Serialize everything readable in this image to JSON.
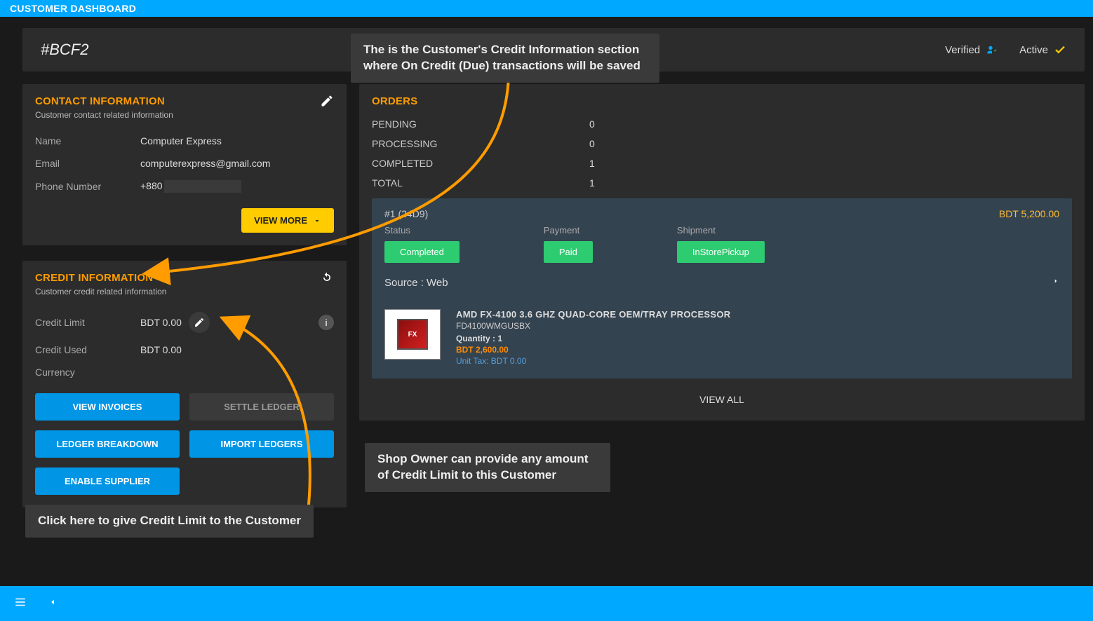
{
  "topbar": {
    "title": "CUSTOMER DASHBOARD"
  },
  "header": {
    "customer_id": "#BCF2",
    "verified": "Verified",
    "active": "Active"
  },
  "contact": {
    "title": "CONTACT INFORMATION",
    "subtitle": "Customer contact related information",
    "name_label": "Name",
    "name_value": "Computer Express",
    "email_label": "Email",
    "email_value": "computerexpress@gmail.com",
    "phone_label": "Phone Number",
    "phone_value": "+880",
    "view_more": "VIEW MORE"
  },
  "credit": {
    "title": "CREDIT INFORMATION",
    "subtitle": "Customer credit related information",
    "limit_label": "Credit Limit",
    "limit_value": "BDT 0.00",
    "used_label": "Credit Used",
    "used_value": "BDT 0.00",
    "currency_label": "Currency",
    "btn_invoices": "VIEW INVOICES",
    "btn_settle": "SETTLE LEDGER",
    "btn_breakdown": "LEDGER BREAKDOWN",
    "btn_import": "IMPORT LEDGERS",
    "btn_supplier": "ENABLE SUPPLIER"
  },
  "orders": {
    "title": "ORDERS",
    "pending_label": "PENDING",
    "pending_val": "0",
    "processing_label": "PROCESSING",
    "processing_val": "0",
    "completed_label": "COMPLETED",
    "completed_val": "1",
    "total_label": "TOTAL",
    "total_val": "1",
    "view_all": "VIEW ALL"
  },
  "order": {
    "title": "#1 (24D9)",
    "amount": "BDT 5,200.00",
    "status_label": "Status",
    "status_val": "Completed",
    "payment_label": "Payment",
    "payment_val": "Paid",
    "shipment_label": "Shipment",
    "shipment_val": "InStorePickup",
    "source_label": "Source : Web",
    "product_name": "AMD FX-4100 3.6 GHZ QUAD-CORE OEM/TRAY PROCESSOR",
    "product_code": "FD4100WMGUSBX",
    "product_qty": "Quantity : 1",
    "product_price": "BDT 2,600.00",
    "product_tax": "Unit Tax: BDT 0.00",
    "chip_text": "FX"
  },
  "annot": {
    "top": "The is the Customer's Credit Information section where On Credit (Due) transactions will be saved",
    "right": "Shop Owner can provide any amount of Credit Limit to this Customer",
    "bottom": "Click here to give Credit Limit to the Customer"
  }
}
